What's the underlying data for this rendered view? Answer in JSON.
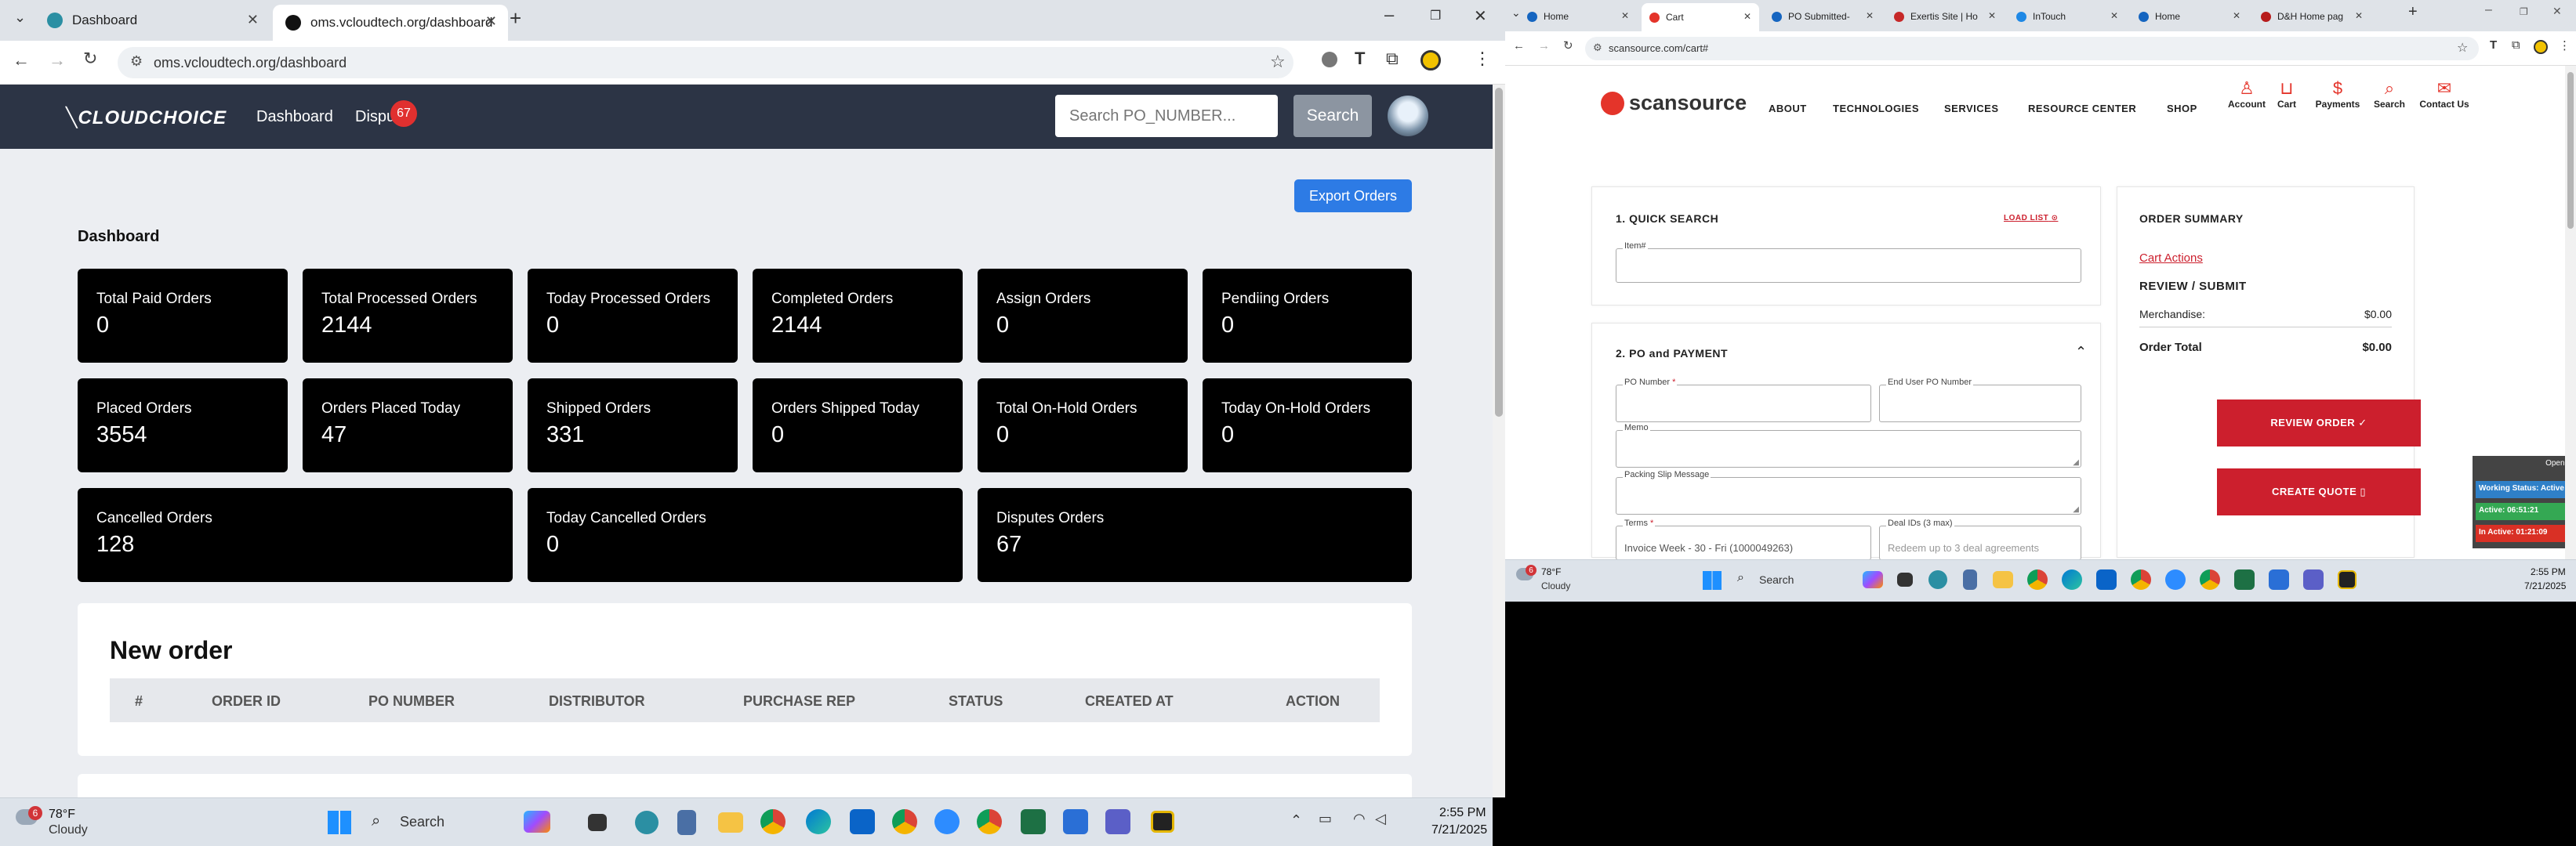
{
  "left_browser": {
    "tabs": [
      {
        "label": "Dashboard",
        "active": false
      },
      {
        "label": "oms.vcloudtech.org/dashboard",
        "active": true
      }
    ],
    "url": "oms.vcloudtech.org/dashboard",
    "brand": "CLOUDCHOICE",
    "nav": {
      "dashboard": "Dashboard",
      "disputes": "Dispu",
      "disputes_badge": "67"
    },
    "search": {
      "placeholder": "Search PO_NUMBER...",
      "button": "Search"
    },
    "export_button": "Export Orders",
    "title": "Dashboard",
    "cards": [
      {
        "label": "Total Paid Orders",
        "value": "0"
      },
      {
        "label": "Total Processed Orders",
        "value": "2144"
      },
      {
        "label": "Today Processed Orders",
        "value": "0"
      },
      {
        "label": "Completed Orders",
        "value": "2144"
      },
      {
        "label": "Assign Orders",
        "value": "0"
      },
      {
        "label": "Pendiing Orders",
        "value": "0"
      },
      {
        "label": "Placed Orders",
        "value": "3554"
      },
      {
        "label": "Orders Placed Today",
        "value": "47"
      },
      {
        "label": "Shipped Orders",
        "value": "331"
      },
      {
        "label": "Orders Shipped Today",
        "value": "0"
      },
      {
        "label": "Total On-Hold Orders",
        "value": "0"
      },
      {
        "label": "Today On-Hold Orders",
        "value": "0"
      },
      {
        "label": "Cancelled Orders",
        "value": "128"
      },
      {
        "label": "Today Cancelled Orders",
        "value": "0"
      },
      {
        "label": "Disputes Orders",
        "value": "67"
      }
    ],
    "new_order": {
      "title": "New order",
      "columns": [
        "#",
        "ORDER ID",
        "PO NUMBER",
        "DISTRIBUTOR",
        "PURCHASE REP",
        "STATUS",
        "CREATED AT",
        "ACTION"
      ]
    }
  },
  "right_browser": {
    "tabs": [
      "Home",
      "Cart",
      "PO Submitted-",
      "Exertis Site | Ho",
      "InTouch",
      "Home",
      "D&H Home pag"
    ],
    "url": "scansource.com/cart#",
    "logo": "scansource",
    "nav": [
      "ABOUT",
      "TECHNOLOGIES",
      "SERVICES",
      "RESOURCE CENTER",
      "SHOP"
    ],
    "icons": [
      "Account",
      "Cart",
      "Payments",
      "Search",
      "Contact Us"
    ],
    "quick_search": {
      "title": "1. QUICK SEARCH",
      "load_list": "LOAD LIST",
      "item_label": "Item#"
    },
    "po_payment": {
      "title": "2. PO and PAYMENT",
      "po_number": "PO Number",
      "end_user_po": "End User PO Number",
      "memo": "Memo",
      "packing": "Packing Slip Message",
      "terms": "Terms",
      "terms_value": "Invoice Week - 30 - Fri (1000049263)",
      "deal_ids": "Deal IDs (3 max)",
      "deal_placeholder": "Redeem up to 3 deal agreements"
    },
    "summary": {
      "title": "ORDER SUMMARY",
      "cart_actions": "Cart Actions",
      "review_submit": "REVIEW / SUBMIT",
      "merch_label": "Merchandise:",
      "merch_value": "$0.00",
      "total_label": "Order Total",
      "total_value": "$0.00",
      "review_btn": "REVIEW ORDER ✓",
      "quote_btn": "CREATE QUOTE ▯"
    },
    "widget": {
      "open": "Open Ap",
      "working": "Working Status: Active",
      "active": "Active: 06:51:21",
      "inactive": "In Active: 01:21:09"
    }
  },
  "taskbar_left": {
    "weather_temp": "78°F",
    "weather_desc": "Cloudy",
    "weather_badge": "6",
    "search": "Search",
    "time": "2:55 PM",
    "date": "7/21/2025"
  },
  "taskbar_right": {
    "weather_temp": "78°F",
    "weather_desc": "Cloudy",
    "weather_badge": "6",
    "search": "Search",
    "time": "2:55 PM",
    "date": "7/21/2025"
  },
  "colors": {
    "navbar": "#2c3445",
    "card": "#000000",
    "accent_blue": "#2d7be5",
    "badge_red": "#e0302f",
    "scansource_red": "#cc1f2d"
  }
}
